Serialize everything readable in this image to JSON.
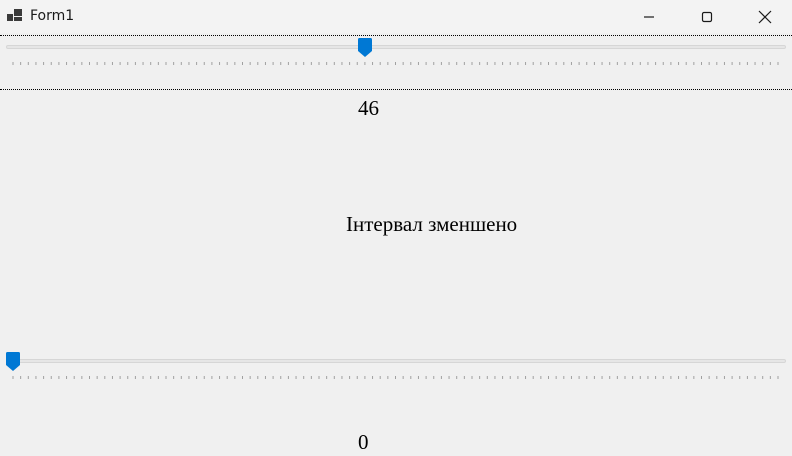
{
  "window": {
    "title": "Form1"
  },
  "trackbar1": {
    "value": 46,
    "min": 0,
    "max": 100,
    "accent": "#0078d4"
  },
  "label1": {
    "text": "46"
  },
  "status": {
    "text": "Інтервал зменшено"
  },
  "trackbar2": {
    "value": 0,
    "min": 0,
    "max": 100,
    "accent": "#0078d4"
  },
  "label2": {
    "text": "0"
  },
  "icons": {
    "app": "window-app-icon",
    "minimize": "minimize-icon",
    "maximize": "maximize-icon",
    "close": "close-icon"
  }
}
